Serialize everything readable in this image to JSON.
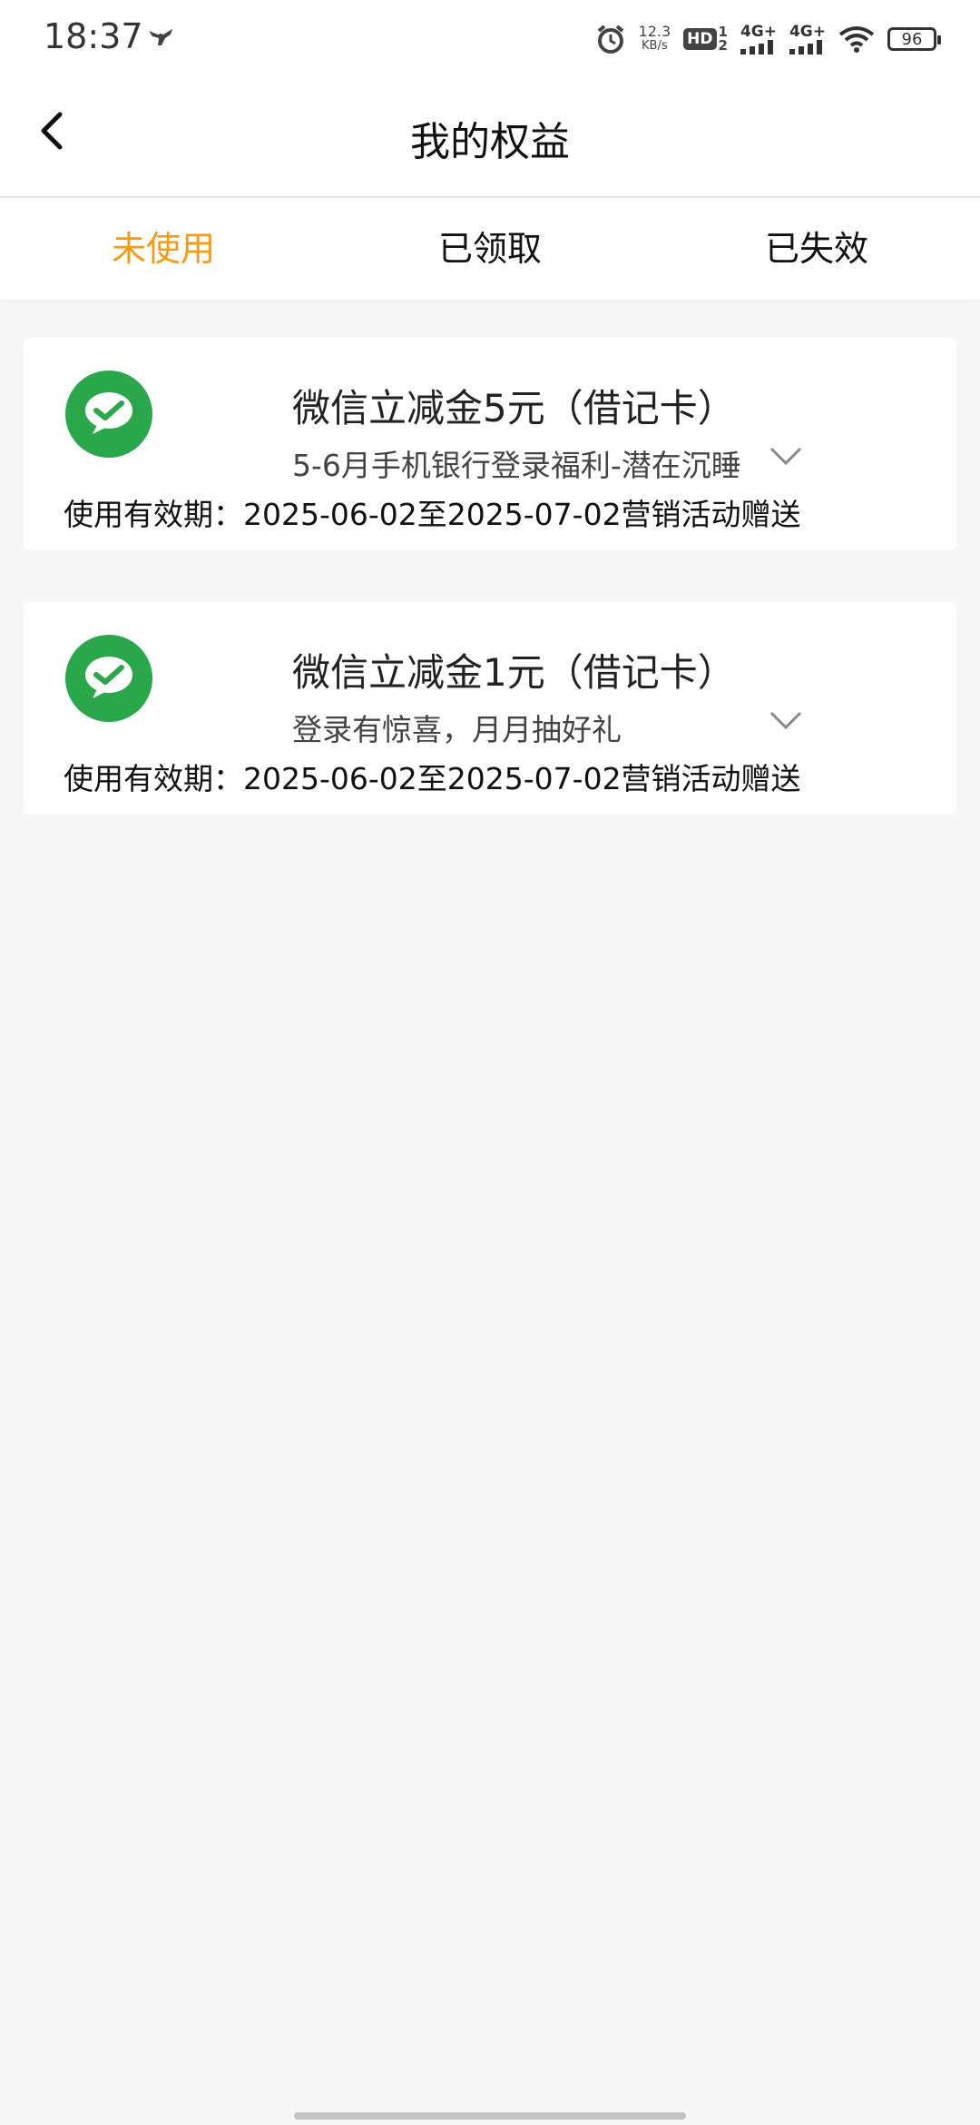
{
  "status_bar": {
    "time": "18:37",
    "speed_value": "12.3",
    "speed_unit": "KB/s",
    "hd_label": "HD",
    "sim_label_top": "1",
    "sim_label_bottom": "2",
    "network1": "4G+",
    "network2": "4G+",
    "battery": "96"
  },
  "header": {
    "title": "我的权益"
  },
  "tabs": [
    {
      "label": "未使用",
      "active": true
    },
    {
      "label": "已领取",
      "active": false
    },
    {
      "label": "已失效",
      "active": false
    }
  ],
  "cards": [
    {
      "title": "微信立减金5元（借记卡）",
      "subtitle": "5-6月手机银行登录福利-潜在沉睡",
      "validity": "使用有效期：2025-06-02至2025-07-02营销活动赠送"
    },
    {
      "title": "微信立减金1元（借记卡）",
      "subtitle": "登录有惊喜，月月抽好礼",
      "validity": "使用有效期：2025-06-02至2025-07-02营销活动赠送"
    }
  ],
  "colors": {
    "accent": "#f39c12",
    "wechat_green": "#2aa74a",
    "background": "#f7f7f7"
  }
}
